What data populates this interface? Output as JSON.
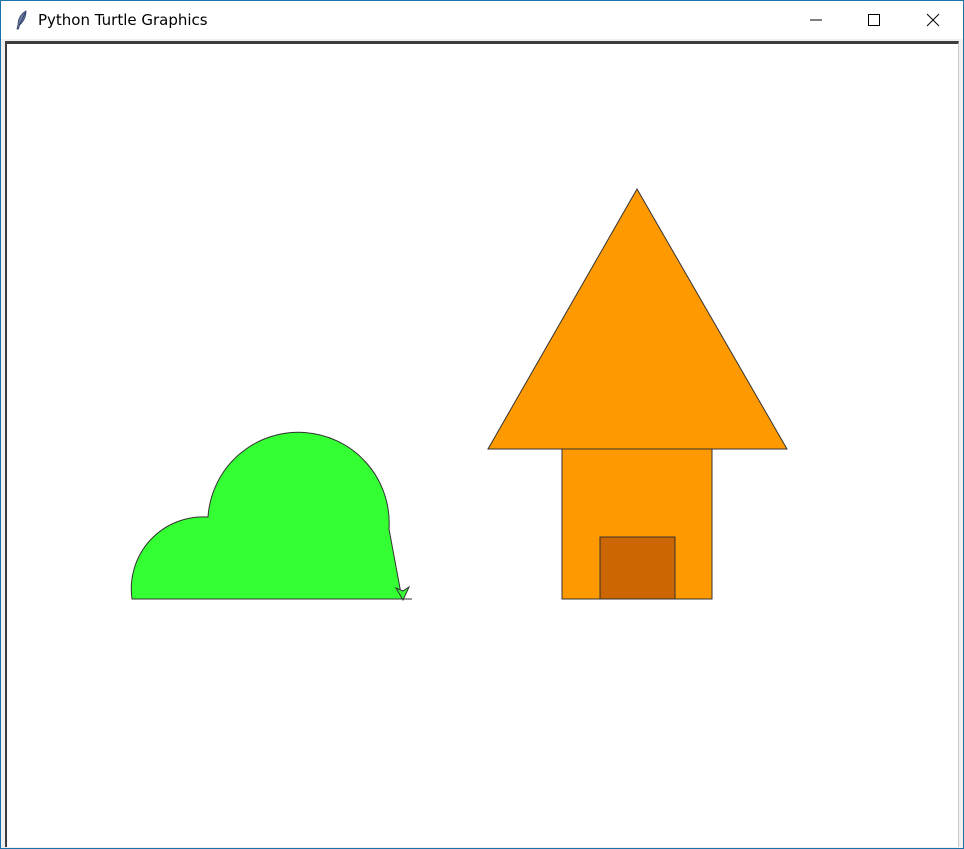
{
  "window": {
    "title": "Python Turtle Graphics"
  },
  "icons": {
    "app": "feather-icon",
    "minimize": "minimize-icon",
    "maximize": "maximize-icon",
    "close": "close-icon"
  },
  "colors": {
    "bush_fill": "#33ff33",
    "house_fill": "#ff9900",
    "door_fill": "#cc6600",
    "outline": "#333333"
  }
}
